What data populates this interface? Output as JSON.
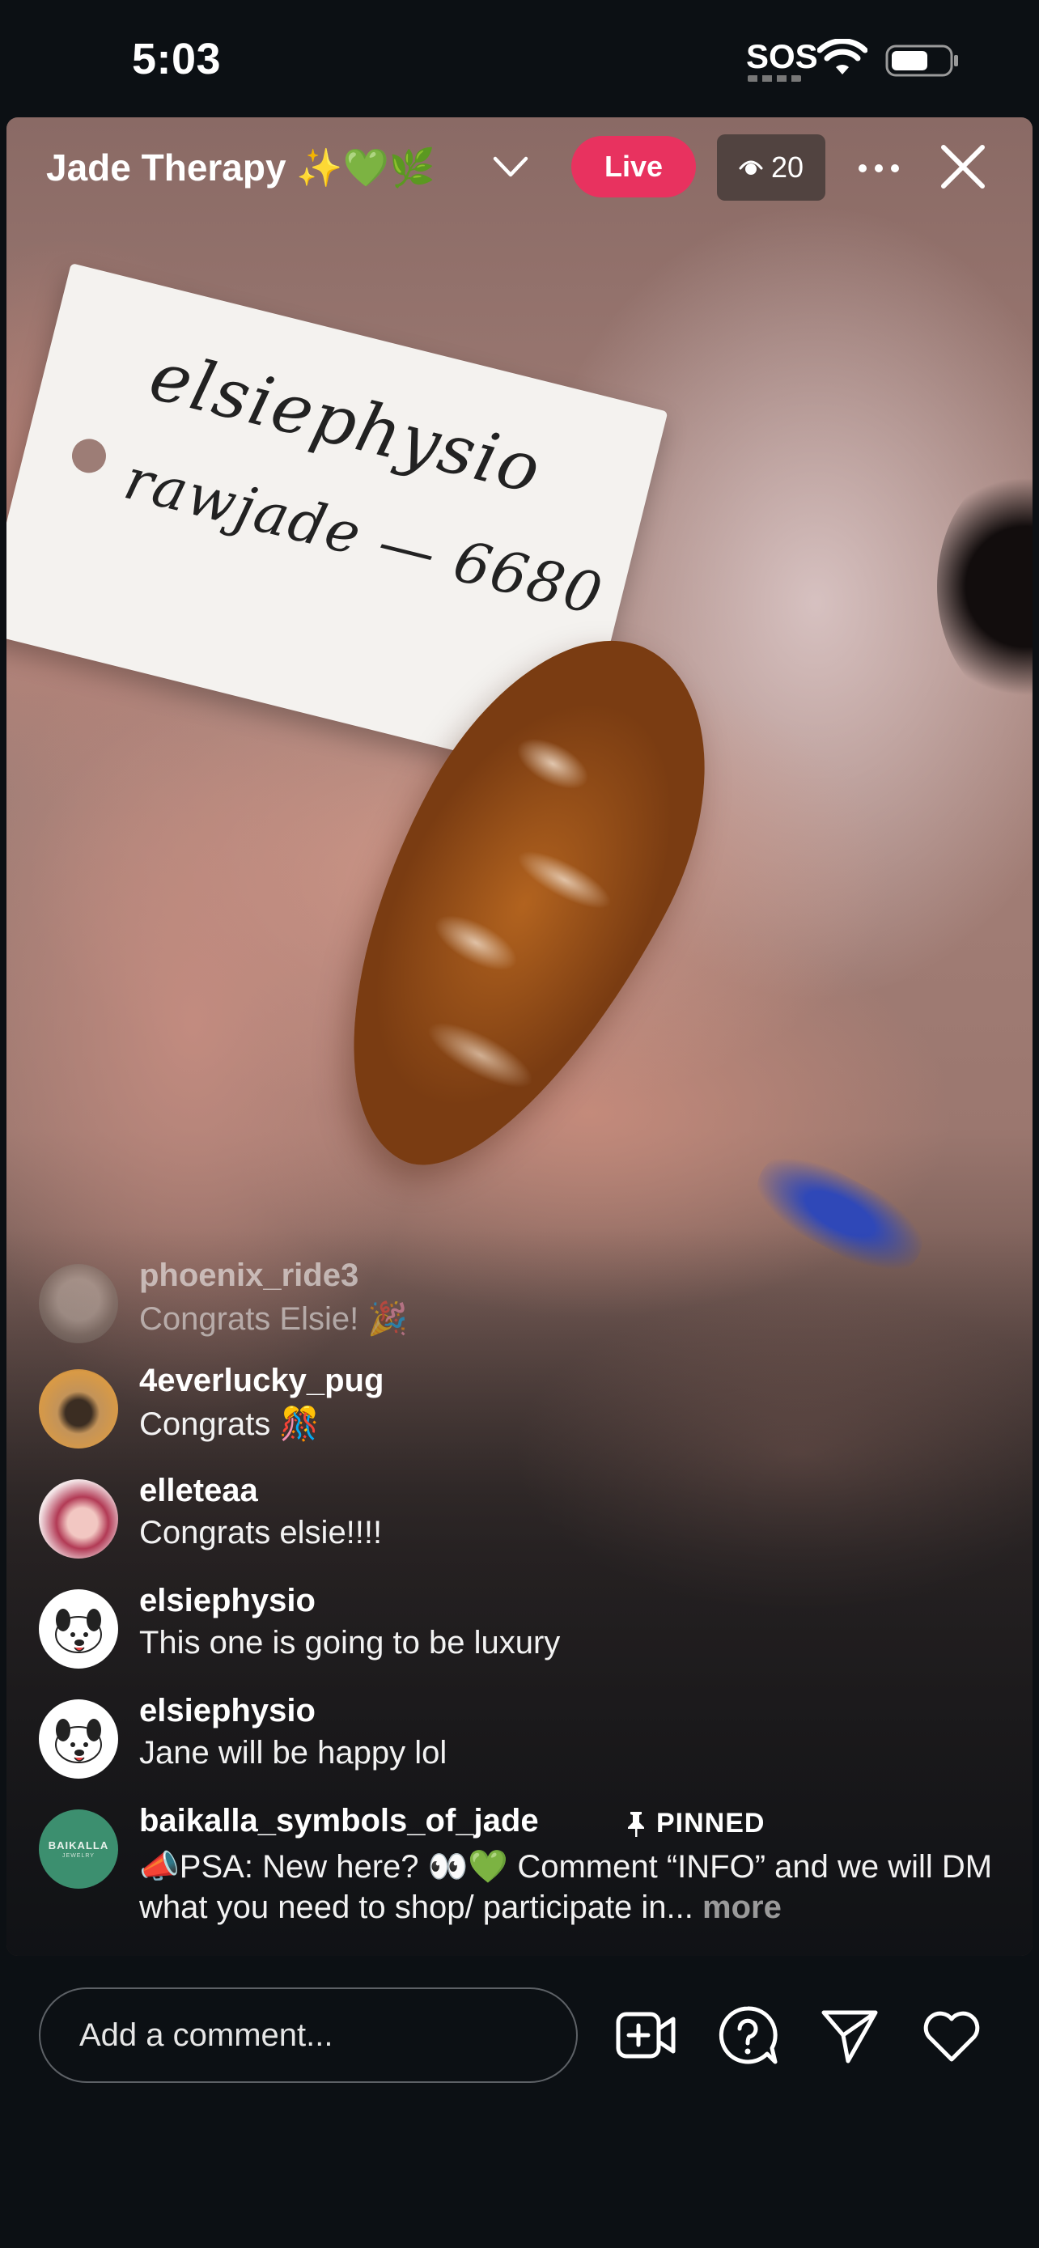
{
  "status_bar": {
    "time": "5:03",
    "sos": "SOS"
  },
  "stream": {
    "title": "Jade Therapy ✨💚🌿",
    "live_label": "Live",
    "viewer_count": "20"
  },
  "video": {
    "tag_line1": "elsiephysio",
    "tag_line2": "rawjade — 6680"
  },
  "comments": [
    {
      "user": "phoenix_ride3",
      "text": "Congrats Elsie! 🎉"
    },
    {
      "user": "4everlucky_pug",
      "text": "Congrats 🎊"
    },
    {
      "user": "elleteaa",
      "text": "Congrats elsie!!!!"
    },
    {
      "user": "elsiephysio",
      "text": "This one is going to be luxury"
    },
    {
      "user": "elsiephysio",
      "text": "Jane will be happy lol"
    }
  ],
  "pinned_comment": {
    "user": "baikalla_symbols_of_jade",
    "pinned_label": "PINNED",
    "text": "📣PSA: New here? 👀💚 Comment “INFO” and we will DM what you need to shop/ participate in...",
    "more_label": "more",
    "avatar_logo": "BAIKALLA",
    "avatar_logo_sub": "JEWELRY"
  },
  "bottom_bar": {
    "comment_placeholder": "Add a comment..."
  },
  "colors": {
    "live_badge": "#e8325f",
    "background": "#0c1014"
  },
  "icons": [
    "wifi-icon",
    "battery-icon",
    "chevron-down-icon",
    "eye-icon",
    "more-icon",
    "close-icon",
    "pin-icon",
    "add-video-icon",
    "question-icon",
    "send-icon",
    "heart-icon"
  ]
}
